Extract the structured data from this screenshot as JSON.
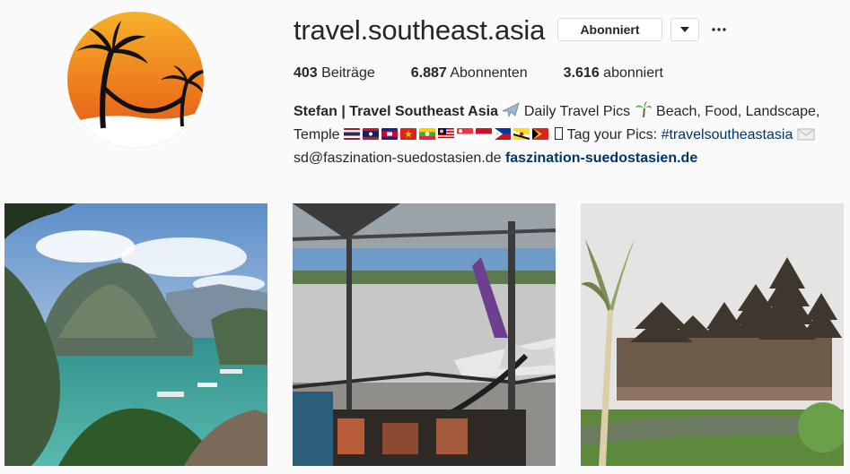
{
  "profile": {
    "username": "travel.southeast.asia",
    "follow_label": "Abonniert",
    "dropdown_icon": "caret-down-icon",
    "more_icon": "more-options-icon"
  },
  "stats": {
    "posts_count": "403",
    "posts_label": "Beiträge",
    "followers_count": "6.887",
    "followers_label": "Abonnenten",
    "following_count": "3.616",
    "following_label": "abonniert"
  },
  "bio": {
    "name": "Stefan | Travel Southeast Asia",
    "text_1": "Daily Travel Pics",
    "text_2": "Beach, Food, Landscape, Temple",
    "text_3": "Tag your Pics:",
    "hashtag": "#travelsoutheastasia",
    "email": "sd@faszination-suedostasien.de",
    "website": "faszination-suedostasien.de",
    "flags": [
      "thailand",
      "laos",
      "cambodia",
      "vietnam",
      "myanmar",
      "malaysia",
      "singapore",
      "indonesia",
      "philippines",
      "brunei",
      "timor-leste"
    ]
  },
  "posts": [
    {
      "name": "post-lagoon",
      "subject": "lagoon-landscape"
    },
    {
      "name": "post-airport",
      "subject": "airport-window-plane"
    },
    {
      "name": "post-temple",
      "subject": "balinese-temple"
    }
  ],
  "colors": {
    "link": "#003569",
    "text": "#262626",
    "border": "#dbdbdb",
    "background": "#fafafa"
  }
}
